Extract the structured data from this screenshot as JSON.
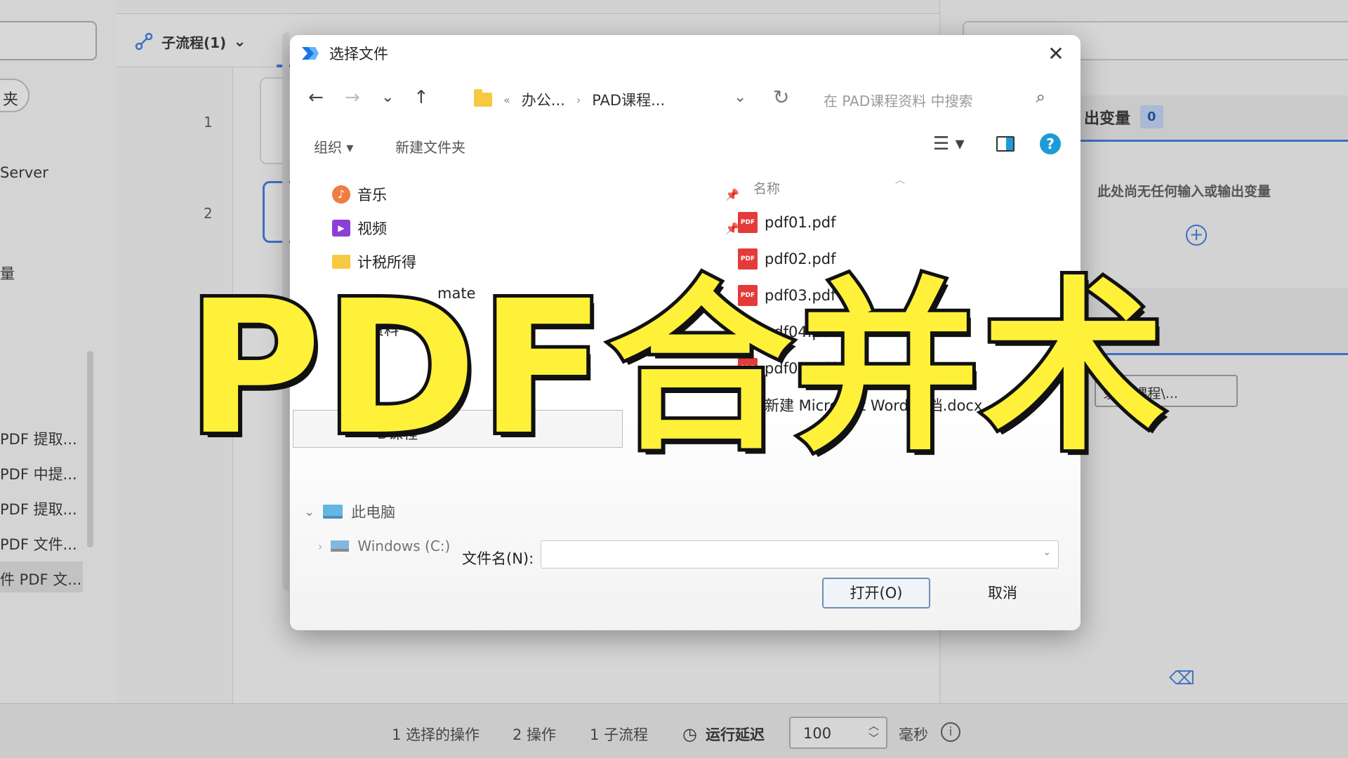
{
  "background": {
    "sidebar": {
      "chip_label": "夹",
      "items": [
        "Server",
        "量"
      ],
      "recent": [
        "PDF 提取...",
        "PDF 中提...",
        "PDF 提取...",
        "PDF 文件...",
        "件 PDF 文..."
      ]
    },
    "tabs": {
      "active_tab": "子流程(1)"
    },
    "line_numbers": [
      "1",
      "2"
    ],
    "right_panel": {
      "var_title": "出变量",
      "var_count": "0",
      "empty_text": "此处尚无任何输入或输出变量",
      "path_button": "录制\\课程\\..."
    },
    "status": {
      "selected_ops": "1 选择的操作",
      "ops": "2 操作",
      "subflows": "1 子流程",
      "delay_label": "运行延迟",
      "delay_value": "100",
      "unit": "毫秒"
    }
  },
  "dialog": {
    "title": "选择文件",
    "close": "✕",
    "nav": {
      "back": "←",
      "forward": "→",
      "recent": "⌄",
      "up": "↑",
      "crumb_more": "«",
      "crumb_1": "办公...",
      "crumb_sep": "›",
      "crumb_2": "PAD课程...",
      "dropdown": "⌄",
      "refresh": "↻",
      "search_placeholder": "在 PAD课程资料 中搜索",
      "search_icon": "⌕"
    },
    "toolbar": {
      "organize": "组织 ▾",
      "new_folder": "新建文件夹",
      "view": "☰ ▾",
      "help": "?"
    },
    "tree": {
      "items": [
        {
          "label": "音乐",
          "icon": "music-icon",
          "pinned": true
        },
        {
          "label": "视频",
          "icon": "video-icon",
          "pinned": true
        },
        {
          "label": "计税所得",
          "icon": "folder-icon",
          "pinned": false
        },
        {
          "label": "mate",
          "icon": "folder-icon",
          "pinned": false
        },
        {
          "label": "程资料",
          "icon": "folder-icon",
          "pinned": false
        },
        {
          "label": "D课程",
          "icon": "folder-icon",
          "pinned": false
        }
      ],
      "this_pc": "此电脑",
      "drive": "Windows (C:)"
    },
    "files": {
      "column_name": "名称",
      "items": [
        "pdf01.pdf",
        "pdf02.pdf",
        "pdf03.pdf",
        "pdf04.pdf",
        "pdf05.pdf",
        "新建 Microsoft Word 文档.docx"
      ]
    },
    "filename_label": "文件名(N):",
    "filename_value": "",
    "open_button": "打开(O)",
    "cancel_button": "取消"
  },
  "overlay": {
    "headline": "PDF合并术"
  },
  "colors": {
    "accent": "#3c70c2",
    "headline_fill": "#fff13a",
    "pdf_red": "#e53a3a"
  }
}
